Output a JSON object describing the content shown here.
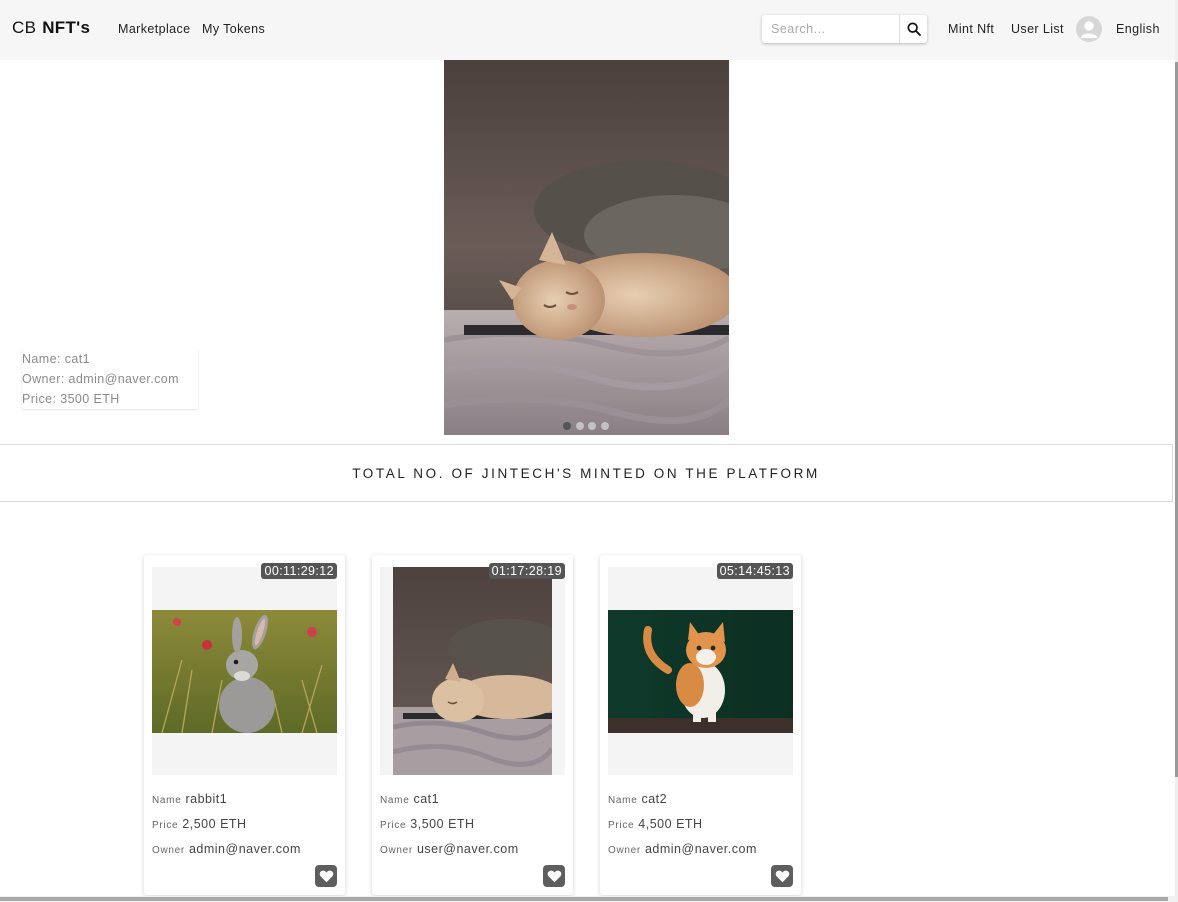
{
  "brand": {
    "prefix": "CB",
    "name": "NFT's"
  },
  "nav": {
    "marketplace": "Marketplace",
    "my_tokens": "My Tokens",
    "mint": "Mint Nft",
    "user_list": "User List",
    "language": "English"
  },
  "search": {
    "placeholder": "Search...",
    "value": ""
  },
  "hero": {
    "name_line": "Name: cat1",
    "owner_line": "Owner: admin@naver.com",
    "price_line": "Price: 3500 ETH",
    "slide_count": 4,
    "active_slide": 1
  },
  "banner": "TOTAL NO. OF JINTECH'S MINTED ON THE PLATFORM",
  "labels": {
    "name": "Name",
    "price": "Price",
    "owner": "Owner"
  },
  "cards": [
    {
      "timer": "00:11:29:12",
      "name": "rabbit1",
      "price": "2,500",
      "unit": "ETH",
      "owner": "admin@naver.com",
      "image": "rabbit"
    },
    {
      "timer": "01:17:28:19",
      "name": "cat1",
      "price": "3,500",
      "unit": "ETH",
      "owner": "user@naver.com",
      "image": "sleeping-cat"
    },
    {
      "timer": "05:14:45:13",
      "name": "cat2",
      "price": "4,500",
      "unit": "ETH",
      "owner": "admin@naver.com",
      "image": "orange-cat"
    }
  ]
}
